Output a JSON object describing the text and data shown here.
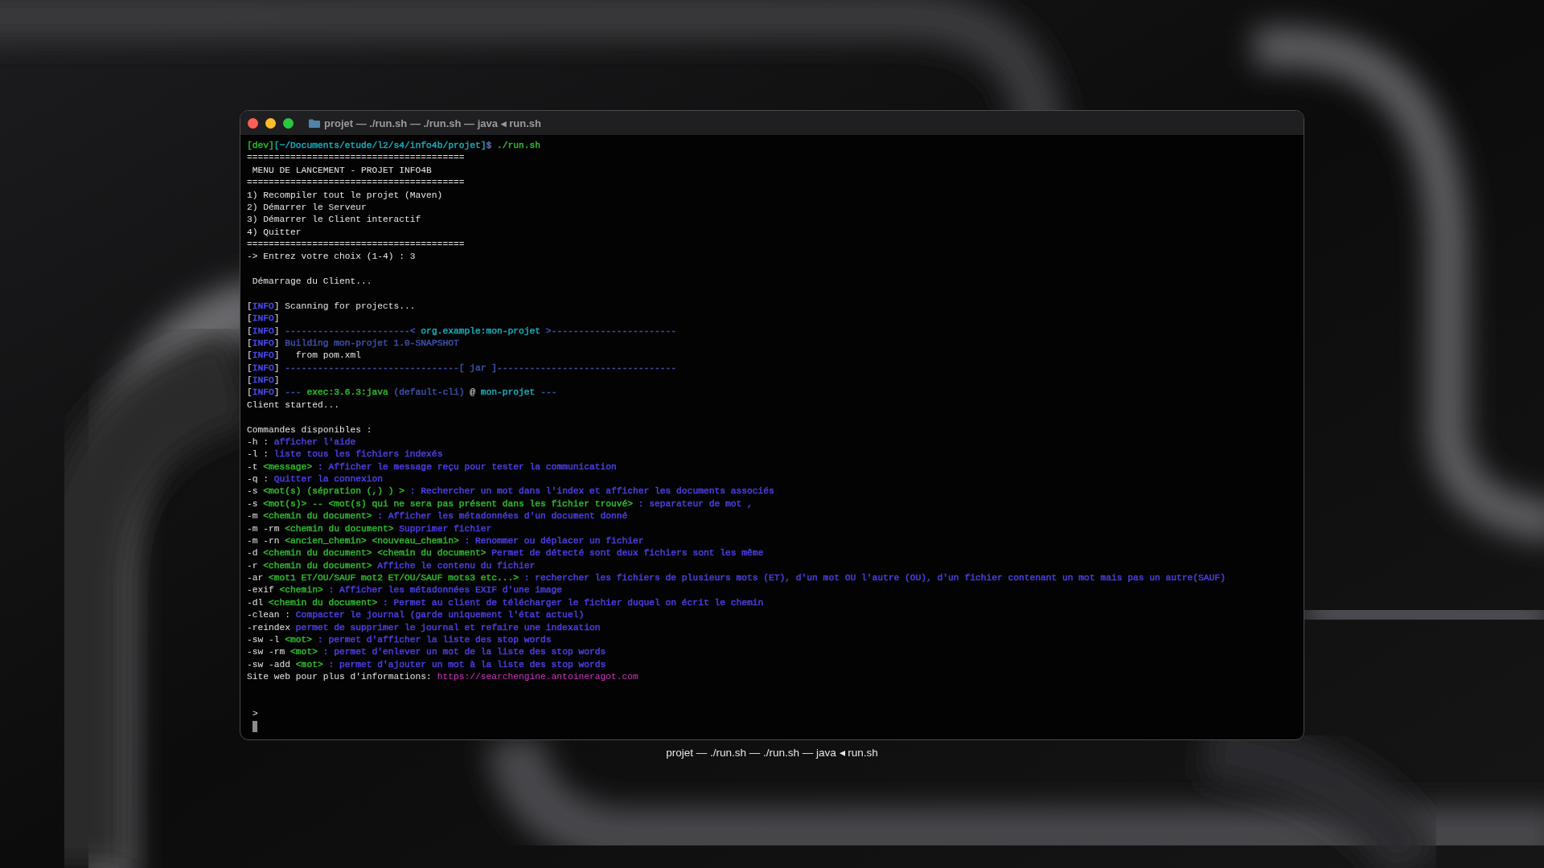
{
  "window": {
    "title": "projet — ./run.sh — ./run.sh — java ◂ run.sh"
  },
  "blocks": [
    [
      {
        "segments": [
          {
            "text": "[dev]",
            "color": "#2fb52f"
          },
          {
            "text": "[~/Documents/etude/l2/s4/info4b/projet]",
            "color": "#19a6b6"
          },
          {
            "text": "$",
            "color": "#5a6cb5"
          },
          {
            "text": " ./run.sh",
            "color": "#2fb52f"
          }
        ]
      },
      {
        "segments": [
          {
            "text": "========================================"
          }
        ]
      },
      {
        "segments": [
          {
            "text": " MENU DE LANCEMENT - PROJET INFO4B"
          }
        ]
      },
      {
        "segments": [
          {
            "text": "========================================"
          }
        ]
      },
      {
        "segments": [
          {
            "text": "1) Recompiler tout le projet (Maven)"
          }
        ]
      },
      {
        "segments": [
          {
            "text": "2) Démarrer le Serveur"
          }
        ]
      },
      {
        "segments": [
          {
            "text": "3) Démarrer le Client interactif"
          }
        ]
      },
      {
        "segments": [
          {
            "text": "4) Quitter"
          }
        ]
      },
      {
        "segments": [
          {
            "text": "========================================"
          }
        ]
      },
      {
        "segments": [
          {
            "text": "-> Entrez votre choix (1-4) : 3"
          }
        ]
      }
    ],
    [
      {
        "segments": [
          {
            "text": " Démarrage du Client..."
          }
        ]
      }
    ],
    [
      {
        "segments": [
          {
            "text": "["
          },
          {
            "text": "INFO",
            "color": "#4b4bf0"
          },
          {
            "text": "] Scanning for projects..."
          }
        ]
      },
      {
        "segments": [
          {
            "text": "["
          },
          {
            "text": "INFO",
            "color": "#4b4bf0"
          },
          {
            "text": "]"
          }
        ]
      },
      {
        "segments": [
          {
            "text": "["
          },
          {
            "text": "INFO",
            "color": "#4b4bf0"
          },
          {
            "text": "] "
          },
          {
            "text": "-----------------------< ",
            "color": "#3d4fa6"
          },
          {
            "text": "org.example:mon-projet",
            "color": "#19a6b6"
          },
          {
            "text": " >-----------------------",
            "color": "#3d4fa6"
          }
        ]
      },
      {
        "segments": [
          {
            "text": "["
          },
          {
            "text": "INFO",
            "color": "#4b4bf0"
          },
          {
            "text": "] "
          },
          {
            "text": "Building mon-projet 1.0-SNAPSHOT",
            "color": "#3d4fa6"
          }
        ]
      },
      {
        "segments": [
          {
            "text": "["
          },
          {
            "text": "INFO",
            "color": "#4b4bf0"
          },
          {
            "text": "]   from pom.xml"
          }
        ]
      },
      {
        "segments": [
          {
            "text": "["
          },
          {
            "text": "INFO",
            "color": "#4b4bf0"
          },
          {
            "text": "] "
          },
          {
            "text": "--------------------------------[ jar ]---------------------------------",
            "color": "#3d4fa6"
          }
        ]
      },
      {
        "segments": [
          {
            "text": "["
          },
          {
            "text": "INFO",
            "color": "#4b4bf0"
          },
          {
            "text": "]"
          }
        ]
      },
      {
        "segments": [
          {
            "text": "["
          },
          {
            "text": "INFO",
            "color": "#4b4bf0"
          },
          {
            "text": "] "
          },
          {
            "text": "--- ",
            "color": "#3d4fa6"
          },
          {
            "text": "exec:3.6.3:java",
            "color": "#2fb52f"
          },
          {
            "text": " (default-cli)",
            "color": "#3d4fa6"
          },
          {
            "text": " @ "
          },
          {
            "text": "mon-projet",
            "color": "#19a6b6"
          },
          {
            "text": " ---",
            "color": "#3d4fa6"
          }
        ]
      },
      {
        "segments": [
          {
            "text": "Client started..."
          }
        ]
      }
    ],
    [
      {
        "segments": [
          {
            "text": "Commandes disponibles :"
          }
        ]
      },
      {
        "segments": [
          {
            "text": "-h : "
          },
          {
            "text": "afficher l'aide",
            "color": "#4a3fe0"
          }
        ]
      },
      {
        "segments": [
          {
            "text": "-l : "
          },
          {
            "text": "liste tous les fichiers indexés",
            "color": "#4a3fe0"
          }
        ]
      },
      {
        "segments": [
          {
            "text": "-t "
          },
          {
            "text": "<message>",
            "color": "#2fb52f"
          },
          {
            "text": " : Afficher le message reçu pour tester la communication",
            "color": "#4a3fe0"
          }
        ]
      },
      {
        "segments": [
          {
            "text": "-q : "
          },
          {
            "text": "Quitter la connexion",
            "color": "#4a3fe0"
          }
        ]
      },
      {
        "segments": [
          {
            "text": "-s "
          },
          {
            "text": "<mot(s) (sépration (,) ) >",
            "color": "#2fb52f"
          },
          {
            "text": " : Rechercher un mot dans l'index et afficher les documents associés",
            "color": "#4a3fe0"
          }
        ]
      },
      {
        "segments": [
          {
            "text": "-s "
          },
          {
            "text": "<mot(s)> -- <mot(s) qui ne sera pas présent dans les fichier trouvé>",
            "color": "#2fb52f"
          },
          {
            "text": " : separateur de mot ,",
            "color": "#4a3fe0"
          }
        ]
      },
      {
        "segments": [
          {
            "text": "-m "
          },
          {
            "text": "<chemin du document>",
            "color": "#2fb52f"
          },
          {
            "text": " : Afficher les métadonnées d'un document donné",
            "color": "#4a3fe0"
          }
        ]
      },
      {
        "segments": [
          {
            "text": "-m -rm "
          },
          {
            "text": "<chemin du document>",
            "color": "#2fb52f"
          },
          {
            "text": " Supprimer fichier",
            "color": "#4a3fe0"
          }
        ]
      },
      {
        "segments": [
          {
            "text": "-m -rn "
          },
          {
            "text": "<ancien_chemin> <nouveau_chemin>",
            "color": "#2fb52f"
          },
          {
            "text": " : Renommer ou déplacer un fichier",
            "color": "#4a3fe0"
          }
        ]
      },
      {
        "segments": [
          {
            "text": "-d "
          },
          {
            "text": "<chemin du document> <chemin du document>",
            "color": "#2fb52f"
          },
          {
            "text": " Permet de détecté sont deux fichiers sont les même",
            "color": "#4a3fe0"
          }
        ]
      },
      {
        "segments": [
          {
            "text": "-r "
          },
          {
            "text": "<chemin du document>",
            "color": "#2fb52f"
          },
          {
            "text": " Affiche le contenu du fichier",
            "color": "#4a3fe0"
          }
        ]
      },
      {
        "segments": [
          {
            "text": "-ar "
          },
          {
            "text": "<mot1 ET/OU/SAUF mot2 ET/OU/SAUF mots3 etc...>",
            "color": "#2fb52f"
          },
          {
            "text": " : rechercher les fichiers de plusieurs mots (ET), d'un mot OU l'autre (OU), d'un fichier contenant un mot mais pas un autre(SAUF)",
            "color": "#4a3fe0"
          }
        ]
      },
      {
        "segments": [
          {
            "text": "-exif "
          },
          {
            "text": "<chemin>",
            "color": "#2fb52f"
          },
          {
            "text": " : Afficher les métadonnées EXIF d'une image",
            "color": "#4a3fe0"
          }
        ]
      },
      {
        "segments": [
          {
            "text": "-dl "
          },
          {
            "text": "<chemin du document>",
            "color": "#2fb52f"
          },
          {
            "text": " : Permet au client de télécharger le fichier duquel on écrit le chemin",
            "color": "#4a3fe0"
          }
        ]
      },
      {
        "segments": [
          {
            "text": "-clean : "
          },
          {
            "text": "Compacter le journal (garde uniquement l'état actuel)",
            "color": "#4a3fe0"
          }
        ]
      },
      {
        "segments": [
          {
            "text": "-reindex "
          },
          {
            "text": "permet de supprimer le journal et refaire une indexation",
            "color": "#4a3fe0"
          }
        ]
      },
      {
        "segments": [
          {
            "text": "-sw -l "
          },
          {
            "text": "<mot>",
            "color": "#2fb52f"
          },
          {
            "text": " : permet d'afficher la liste des stop words",
            "color": "#4a3fe0"
          }
        ]
      },
      {
        "segments": [
          {
            "text": "-sw -rm "
          },
          {
            "text": "<mot>",
            "color": "#2fb52f"
          },
          {
            "text": " : permet d'enlever un mot de la liste des stop words",
            "color": "#4a3fe0"
          }
        ]
      },
      {
        "segments": [
          {
            "text": "-sw -add "
          },
          {
            "text": "<mot>",
            "color": "#2fb52f"
          },
          {
            "text": " : permet d'ajouter un mot à la liste des stop words",
            "color": "#4a3fe0"
          }
        ]
      }
    ]
  ],
  "website": {
    "label": "Site web pour plus d'informations: ",
    "url": "https://searchengine.antoineragot.com"
  },
  "input_prompt": {
    "symbol": ">"
  },
  "caption": "projet — ./run.sh — ./run.sh — java ◂ run.sh"
}
